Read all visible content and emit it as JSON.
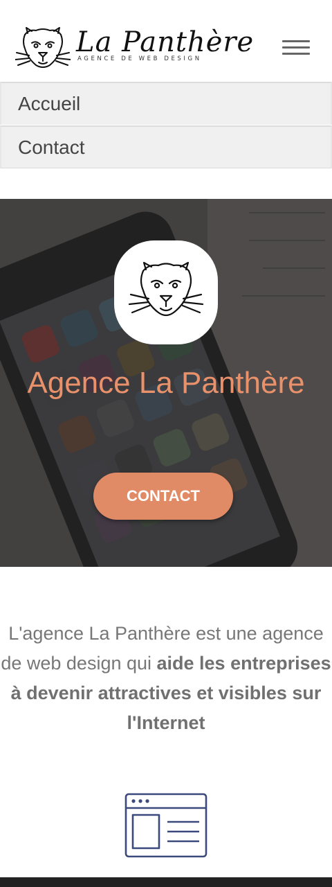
{
  "header": {
    "brand_name": "La Panthère",
    "brand_tagline": "AGENCE DE WEB DESIGN",
    "menu_icon": "hamburger-icon",
    "logo_icon": "panther-head-icon"
  },
  "nav": {
    "items": [
      {
        "label": "Accueil"
      },
      {
        "label": "Contact"
      }
    ]
  },
  "hero": {
    "title": "Agence La Panthère",
    "cta_label": "CONTACT",
    "background": "smartphone-photo",
    "logo_icon": "panther-head-icon"
  },
  "intro": {
    "text_plain": "L'agence La Panthère est une agence de web design qui ",
    "text_bold": "aide les entreprises à devenir attractives et visibles sur l'Internet"
  },
  "feature": {
    "icon": "browser-window-icon"
  },
  "colors": {
    "accent": "#e18b66",
    "title": "#e9916a",
    "icon": "#3b4a7a",
    "text": "#777777"
  }
}
